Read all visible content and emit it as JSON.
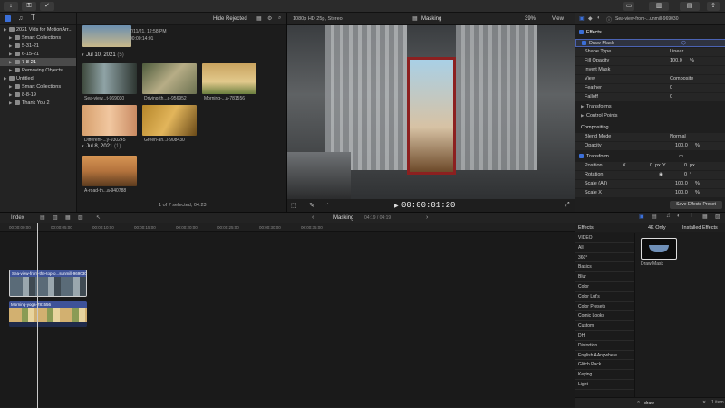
{
  "toolbar": {
    "import_icon": "download-icon",
    "keyword_icon": "key-icon",
    "check_icon": "check-icon"
  },
  "sidebar": {
    "items": [
      {
        "label": "2021 Vids for MotionArr...",
        "level": 0
      },
      {
        "label": "Smart Collections",
        "level": 1
      },
      {
        "label": "5-31-21",
        "level": 1
      },
      {
        "label": "6-15-21",
        "level": 1
      },
      {
        "label": "7-8-21",
        "level": 1,
        "selected": true
      },
      {
        "label": "Removing Objects",
        "level": 1
      },
      {
        "label": "Untitled",
        "level": 0
      },
      {
        "label": "Smart Collections",
        "level": 1
      },
      {
        "label": "8-8-19",
        "level": 1
      },
      {
        "label": "Thank You 2",
        "level": 1
      }
    ]
  },
  "browser": {
    "filter": "Hide Rejected",
    "top_meta_1": "7/11/21, 12:58 PM",
    "top_meta_2": "00:00:14:01",
    "group1_date": "Jul 10, 2021",
    "group1_count": "(5)",
    "clips1": [
      "Sea-view...t-969030",
      "Driving-th...a-956952",
      "Morning-...a-781556",
      "Different-...y-930245",
      "Green-an...l-908430"
    ],
    "group2_date": "Jul 8, 2021",
    "group2_count": "(1)",
    "clips2": [
      "A-road-th...a-940788"
    ],
    "status": "1 of 7 selected, 04:23"
  },
  "viewer": {
    "format": "1080p HD 25p, Stereo",
    "title": "Masking",
    "zoom": "39%",
    "view_label": "View",
    "timecode": "00:00:01:20"
  },
  "inspector": {
    "clip_name": "Sea-view-from-...unmill-969030",
    "effects_label": "Effects",
    "draw_mask": "Draw Mask",
    "rows": [
      {
        "label": "Shape Type",
        "value": "Linear"
      },
      {
        "label": "Fill Opacity",
        "value": "100.0",
        "unit": "%"
      },
      {
        "label": "Invert Mask",
        "value": ""
      },
      {
        "label": "View",
        "value": "Composite"
      },
      {
        "label": "Feather",
        "value": "0"
      },
      {
        "label": "Falloff",
        "value": "0"
      }
    ],
    "transforms": "Transforms",
    "control_points": "Control Points",
    "compositing": "Compositing",
    "blend_mode_label": "Blend Mode",
    "blend_mode_value": "Normal",
    "opacity_label": "Opacity",
    "opacity_value": "100.0",
    "transform_label": "Transform",
    "position_label": "Position",
    "position_x_label": "X",
    "position_x": "0",
    "position_x_unit": "px",
    "position_y_label": "Y",
    "position_y": "0",
    "position_y_unit": "px",
    "rotation_label": "Rotation",
    "rotation_value": "0",
    "scale_all_label": "Scale (All)",
    "scale_all_value": "100.0",
    "scale_x_label": "Scale X",
    "scale_x_value": "100.0",
    "percent": "%",
    "degree": "°",
    "save_preset": "Save Effects Preset"
  },
  "timeline": {
    "index_label": "Index",
    "project": "Masking",
    "duration": "04:19 / 04:19",
    "ruler": [
      "00:00:00:00",
      "00:00:05:00",
      "00:00:10:00",
      "00:00:15:00",
      "00:00:20:00",
      "00:00:25:00",
      "00:00:30:00",
      "00:00:35:00"
    ],
    "clip_top": "Sea-view-from-the-top-o...sunmill-969030",
    "clip_bottom": "Morning-yoga-781556"
  },
  "effects": {
    "title": "Effects",
    "only_4k": "4K Only",
    "installed": "Installed Effects",
    "categories": [
      "VIDEO",
      "All",
      "360°",
      "Basics",
      "Blur",
      "Color",
      "Color Lut's",
      "Color Presets",
      "Comic Looks",
      "Custom",
      "DH",
      "Distortion",
      "English AAnywhere",
      "Glitch Pack",
      "Keying",
      "Light"
    ],
    "result_name": "Draw Mask",
    "search_value": "draw",
    "count": "1 item"
  }
}
